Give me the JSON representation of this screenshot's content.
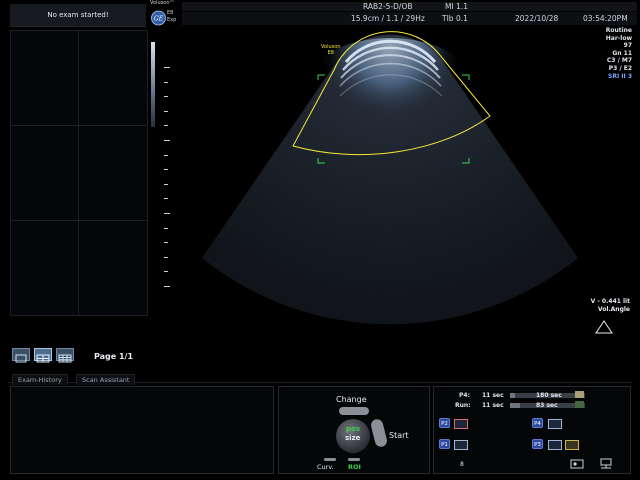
{
  "left_panel": {
    "header": "No exam started!",
    "page_label": "Page 1/1",
    "layout_buttons": [
      "layout-1x1",
      "layout-2x2",
      "layout-3x3"
    ]
  },
  "header": {
    "logo_brand": "Voluson™",
    "logo_model_1": "E8",
    "logo_model_2": "Exp",
    "probe_preset": "RAB2-5-D/OB",
    "mi": "MI 1.1",
    "depth_freq": "15.9cm / 1.1 / 29Hz",
    "tib": "TIb 0.1",
    "date": "2022/10/28",
    "time": "03:54:20PM"
  },
  "params": {
    "mode": "Routine",
    "harmonic": "Har-low",
    "frame": "97",
    "gain": "Gn  11",
    "c_m": "C3 / M7",
    "p_e": "P3 / E2",
    "sri": "SRI II 3"
  },
  "image_area": {
    "box_label_1": "Voluson",
    "box_label_2": "E8"
  },
  "volume": {
    "value": "V - 0.441 lit",
    "angle_label": "Vol.Angle"
  },
  "tabs": {
    "exam_history": "Exam-History",
    "scan_assistant": "Scan Assistant"
  },
  "controls": {
    "change": "Change",
    "pos": "pos",
    "size": "size",
    "start": "Start",
    "curv": "Curv.",
    "roi": "ROI"
  },
  "clips": {
    "p4_label": "P4:",
    "p4_time": "11 sec",
    "p4_val": "180 sec",
    "run_label": "Run:",
    "run_time": "11 sec",
    "run_val": "83 sec",
    "badge_p2": "P2",
    "badge_p4": "P4",
    "badge_p1": "P1",
    "badge_p3": "P3",
    "count": "8",
    "p4_fill": 0.06,
    "run_fill": 0.13
  },
  "colors": {
    "accent_yellow": "#f4ea36",
    "roi_green": "#3fcf4f",
    "sri_blue": "#78a6ff"
  }
}
